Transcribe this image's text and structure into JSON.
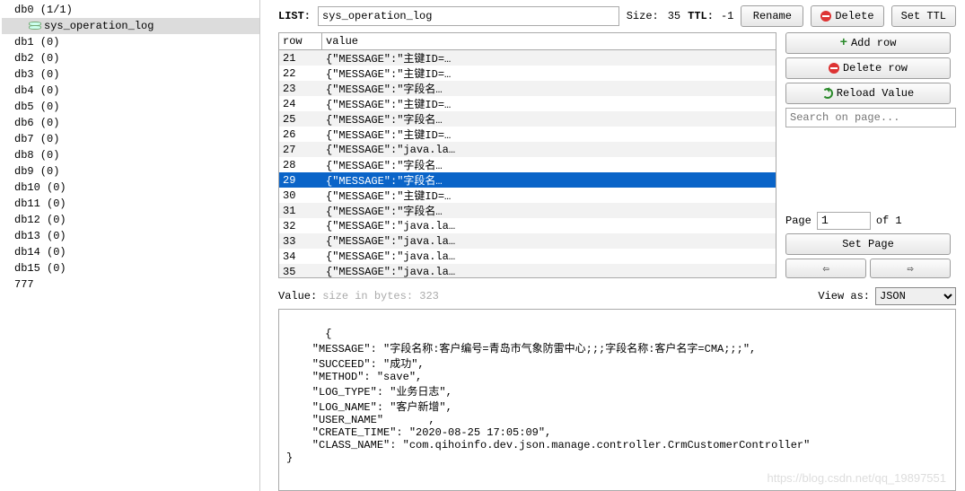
{
  "sidebar": {
    "dbs": [
      {
        "label": "db0  (1/1)",
        "children": [
          {
            "label": "sys_operation_log",
            "selected": true
          }
        ]
      },
      {
        "label": "db1 (0)"
      },
      {
        "label": "db2 (0)"
      },
      {
        "label": "db3 (0)"
      },
      {
        "label": "db4 (0)"
      },
      {
        "label": "db5 (0)"
      },
      {
        "label": "db6 (0)"
      },
      {
        "label": "db7 (0)"
      },
      {
        "label": "db8 (0)"
      },
      {
        "label": "db9 (0)"
      },
      {
        "label": "db10 (0)"
      },
      {
        "label": "db11 (0)"
      },
      {
        "label": "db12 (0)"
      },
      {
        "label": "db13 (0)"
      },
      {
        "label": "db14 (0)"
      },
      {
        "label": "db15 (0)"
      }
    ],
    "footer": "777"
  },
  "header": {
    "list_label": "LIST:",
    "key_name": "sys_operation_log",
    "size_label": "Size:",
    "size_value": "35",
    "ttl_label": "TTL:",
    "ttl_value": "-1",
    "rename_btn": "Rename",
    "delete_btn": "Delete",
    "setttl_btn": "Set TTL"
  },
  "grid": {
    "col_row": "row",
    "col_value": "value",
    "rows": [
      {
        "n": "21",
        "v": "{\"MESSAGE\":\"主键ID=…"
      },
      {
        "n": "22",
        "v": "{\"MESSAGE\":\"主键ID=…"
      },
      {
        "n": "23",
        "v": "{\"MESSAGE\":\"字段名…"
      },
      {
        "n": "24",
        "v": "{\"MESSAGE\":\"主键ID=…"
      },
      {
        "n": "25",
        "v": "{\"MESSAGE\":\"字段名…"
      },
      {
        "n": "26",
        "v": "{\"MESSAGE\":\"主键ID=…"
      },
      {
        "n": "27",
        "v": "{\"MESSAGE\":\"java.la…"
      },
      {
        "n": "28",
        "v": "{\"MESSAGE\":\"字段名…"
      },
      {
        "n": "29",
        "v": "{\"MESSAGE\":\"字段名…",
        "selected": true
      },
      {
        "n": "30",
        "v": "{\"MESSAGE\":\"主键ID=…"
      },
      {
        "n": "31",
        "v": "{\"MESSAGE\":\"字段名…"
      },
      {
        "n": "32",
        "v": "{\"MESSAGE\":\"java.la…"
      },
      {
        "n": "33",
        "v": "{\"MESSAGE\":\"java.la…"
      },
      {
        "n": "34",
        "v": "{\"MESSAGE\":\"java.la…"
      },
      {
        "n": "35",
        "v": "{\"MESSAGE\":\"java.la…"
      }
    ]
  },
  "sidepanel": {
    "addrow": "Add row",
    "deleterow": "Delete row",
    "reload": "Reload Value",
    "search_placeholder": "Search on page...",
    "page_label": "Page",
    "page_value": "1",
    "page_of": "of 1",
    "setpage": "Set Page",
    "left": "⇦",
    "right": "⇨"
  },
  "valuebar": {
    "label": "Value:",
    "hint": "size in bytes: 323",
    "viewas_label": "View as:",
    "viewas_value": "JSON"
  },
  "value_text": "{\n    \"MESSAGE\": \"字段名称:客户编号=青岛市气象防雷中心;;;字段名称:客户名字=CMA;;;\",\n    \"SUCCEED\": \"成功\",\n    \"METHOD\": \"save\",\n    \"LOG_TYPE\": \"业务日志\",\n    \"LOG_NAME\": \"客户新增\",\n    \"USER_NAME\"       ,\n    \"CREATE_TIME\": \"2020-08-25 17:05:09\",\n    \"CLASS_NAME\": \"com.qihoinfo.dev.json.manage.controller.CrmCustomerController\"\n}",
  "watermark": "https://blog.csdn.net/qq_19897551"
}
